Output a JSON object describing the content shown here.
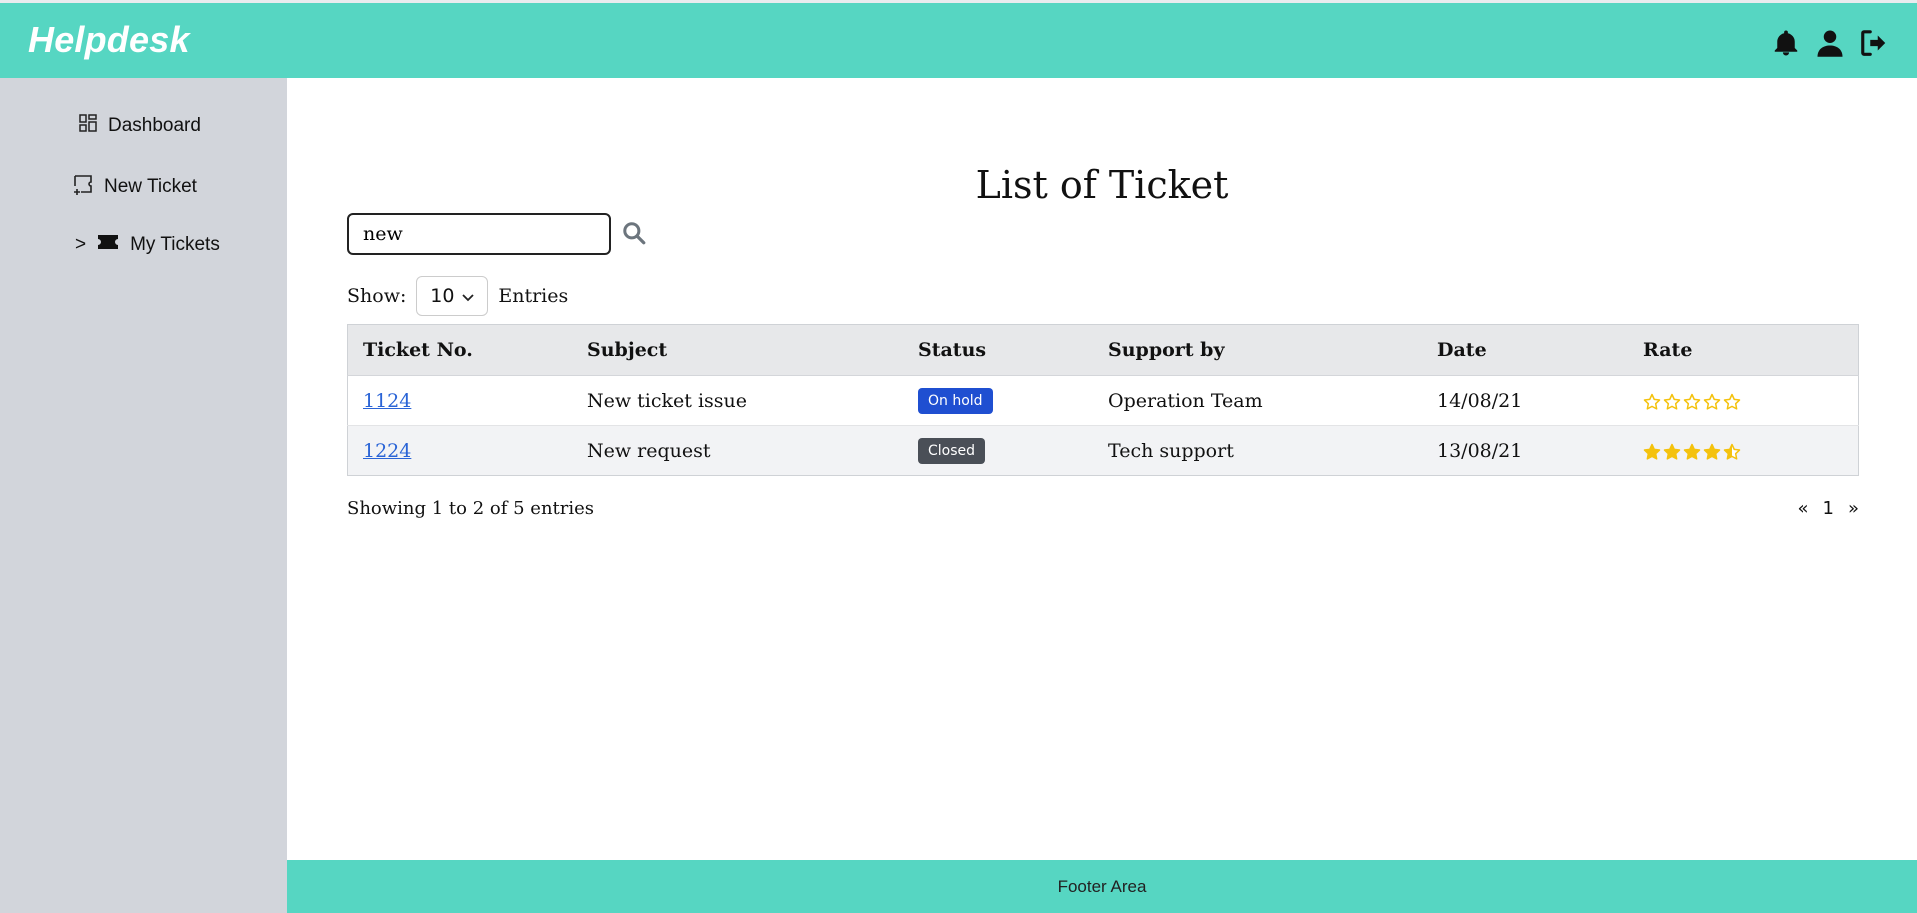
{
  "app": {
    "brand": "Helpdesk"
  },
  "topbar": {
    "icons": [
      "bell-icon",
      "user-icon",
      "logout-icon"
    ]
  },
  "sidebar": {
    "items": [
      {
        "label": "Dashboard",
        "icon": "dashboard-icon"
      },
      {
        "label": "New Ticket",
        "icon": "new-ticket-icon"
      },
      {
        "label": "My Tickets",
        "icon": "ticket-icon",
        "prefix": ">"
      }
    ]
  },
  "main": {
    "title": "List of Ticket",
    "search": {
      "value": "new",
      "icon": "search-icon"
    },
    "show": {
      "label": "Show:",
      "value": "10",
      "suffix": "Entries"
    },
    "table": {
      "headers": [
        "Ticket No.",
        "Subject",
        "Status",
        "Support by",
        "Date",
        "Rate"
      ],
      "rows": [
        {
          "ticket": "1124",
          "subject": "New ticket issue",
          "status": "On hold",
          "status_color": "#1f4fd1",
          "support": "Operation Team",
          "date": "14/08/21",
          "rating": 0
        },
        {
          "ticket": "1224",
          "subject": "New request",
          "status": "Closed",
          "status_color": "#4a4f57",
          "support": "Tech support",
          "date": "13/08/21",
          "rating": 4.5
        }
      ]
    },
    "info": "Showing 1 to 2 of 5 entries",
    "pagination": {
      "prev": "«",
      "page": "1",
      "next": "»"
    }
  },
  "footer": {
    "text": "Footer Area"
  },
  "colors": {
    "accent": "#56d6c2",
    "sidebar": "#d2d5db",
    "star": "#f4c20d",
    "link": "#2a64d6"
  }
}
